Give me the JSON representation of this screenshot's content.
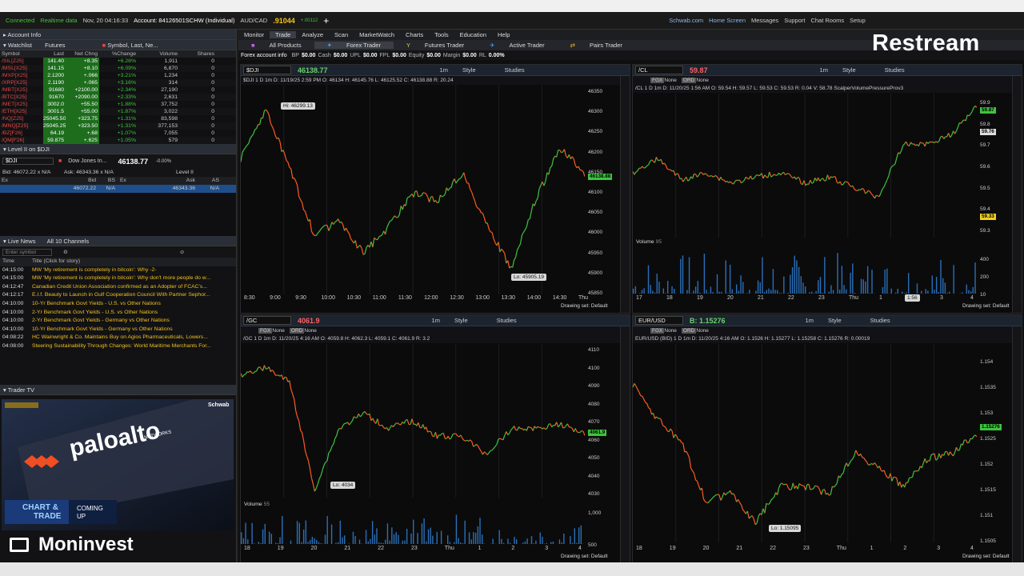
{
  "statusbar": {
    "connected": "Connected",
    "realtime": "Realtime data",
    "datetime": "Nov, 20  04:16:33",
    "account": "Account: 84126501SCHW (Individual)",
    "fx_symbol": "AUD/CAD",
    "fx_price": ".91044",
    "fx_change": "+.00112",
    "links": [
      "Schwab.com",
      "Home Screen",
      "Messages",
      "Support",
      "Chat Rooms",
      "Setup"
    ],
    "ondemand": "OnDemand"
  },
  "left_panel": {
    "account_info": "Account Info",
    "watchlist_label": "Watchlist",
    "watchlist_name": "Futures",
    "symbol_search": "Symbol, Last, Ne...",
    "columns": [
      "Symbol",
      "Last",
      "Net Chng",
      "%Change",
      "Volume",
      "Shares"
    ],
    "rows": [
      {
        "sym": "/SIL[Z25]",
        "last": "141.40",
        "net": "+8.35",
        "pct": "+6.28%",
        "vol": "1,911",
        "sh": "0"
      },
      {
        "sym": "/MSL[X25]",
        "last": "141.15",
        "net": "+8.10",
        "pct": "+6.09%",
        "vol": "6,870",
        "sh": "0"
      },
      {
        "sym": "/MXP[X25]",
        "last": "2.1200",
        "net": "+.066",
        "pct": "+3.21%",
        "vol": "1,234",
        "sh": "0"
      },
      {
        "sym": "/XRP[X25]",
        "last": "2.1190",
        "net": "+.065",
        "pct": "+3.16%",
        "vol": "314",
        "sh": "0"
      },
      {
        "sym": "/MBT[X25]",
        "last": "91680",
        "net": "+2100.00",
        "pct": "+2.34%",
        "vol": "27,190",
        "sh": "0"
      },
      {
        "sym": "/BTC[X25]",
        "last": "91670",
        "net": "+2090.00",
        "pct": "+2.33%",
        "vol": "2,631",
        "sh": "0"
      },
      {
        "sym": "/MET[X25]",
        "last": "3002.0",
        "net": "+55.50",
        "pct": "+1.88%",
        "vol": "37,752",
        "sh": "0"
      },
      {
        "sym": "/ETH[X25]",
        "last": "3001.5",
        "net": "+55.00",
        "pct": "+1.87%",
        "vol": "3,022",
        "sh": "0"
      },
      {
        "sym": "/NQ[Z25]",
        "last": "25045.50",
        "net": "+323.75",
        "pct": "+1.31%",
        "vol": "83,598",
        "sh": "0"
      },
      {
        "sym": "/MNQ[Z25]",
        "last": "25045.25",
        "net": "+323.50",
        "pct": "+1.31%",
        "vol": "377,153",
        "sh": "0"
      },
      {
        "sym": "/BZ[F26]",
        "last": "64.19",
        "net": "+.68",
        "pct": "+1.07%",
        "vol": "7,055",
        "sh": "0"
      },
      {
        "sym": "/QM[F26]",
        "last": "59.875",
        "net": "+.625",
        "pct": "+1.05%",
        "vol": "579",
        "sh": "0"
      }
    ],
    "level2_title": "Level II on $DJI",
    "level2_symbol": "$DJI",
    "level2_name": "Dow Jones In...",
    "level2_price": "46138.77",
    "level2_change": "-0.00%",
    "level2_bid": "Bid: 46072.22 x N/A",
    "level2_ask": "Ask: 46343.36 x N/A",
    "level2_label": "Level II",
    "level2_cols": [
      "Ex",
      "Bid",
      "BS",
      "Ex",
      "Ask",
      "AS"
    ],
    "level2_row": {
      "bid": "46072.22",
      "bs": "N/A",
      "ask": "46343.36",
      "as": "N/A"
    },
    "news_tab1": "Live News",
    "news_tab2": "All 10 Channels",
    "news_symbol_placeholder": "Enter symbol",
    "news_cols": [
      "Time",
      "Title (Click for story)"
    ],
    "news": [
      {
        "t": "04:15:00",
        "h": "MW 'My retirement is completely in bitcoin': Why -2-"
      },
      {
        "t": "04:15:00",
        "h": "MW 'My retirement is completely in bitcoin': Why don't more people do w..."
      },
      {
        "t": "04:12:47",
        "h": "Canadian Credit Union Association confirmed as an Adopter of FCAC's..."
      },
      {
        "t": "04:12:17",
        "h": "E.I.f. Beauty to Launch in Gulf Cooperation Council With Partner Sephor..."
      },
      {
        "t": "04:10:00",
        "h": "10-Yr Benchmark Govt Yields - U.S. vs Other Nations"
      },
      {
        "t": "04:10:00",
        "h": "2-Yr Benchmark Govt Yields - U.S. vs Other Nations"
      },
      {
        "t": "04:10:00",
        "h": "2-Yr Benchmark Govt Yields - Germany vs Other Nations"
      },
      {
        "t": "04:10:00",
        "h": "10-Yr Benchmark Govt Yields - Germany vs Other Nations"
      },
      {
        "t": "04:08:22",
        "h": "HC Wainwright & Co. Maintains Buy on Agios Pharmaceuticals, Lowers..."
      },
      {
        "t": "04:08:00",
        "h": "Steering Sustainability Through Changes: World Maritime Merchants For..."
      }
    ],
    "trader_tv": "Trader TV",
    "tv_brand": "Schwab",
    "tv_logo": "paloalto",
    "tv_logo_sub": "NETWORKS",
    "tv_chart": "CHART &",
    "tv_trade": "TRADE",
    "tv_coming": "COMING",
    "tv_up": "UP"
  },
  "main": {
    "tabs": [
      "Monitor",
      "Trade",
      "Analyze",
      "Scan",
      "MarketWatch",
      "Charts",
      "Tools",
      "Education",
      "Help"
    ],
    "subtabs": [
      "All Products",
      "Forex Trader",
      "Futures Trader",
      "Active Trader",
      "Pairs Trader"
    ],
    "fx_bar": {
      "label": "Forex account info",
      "bp": "BP",
      "bp_v": "$0.00",
      "cash": "Cash",
      "cash_v": "$0.00",
      "upl": "UPL",
      "upl_v": "$0.00",
      "fpl": "FPL",
      "fpl_v": "$0.00",
      "equity": "Equity",
      "equity_v": "$0.00",
      "margin": "Margin",
      "margin_v": "$0.00",
      "rl": "RL",
      "rl_v": "0.00%"
    }
  },
  "charts": {
    "dji": {
      "symbol": "$DJI",
      "price": "46138.77",
      "info": "$DJI 1 D 1m   D: 11/19/25 2:59 PM  O: 46134  H: 46145.76  L: 46125.52  C: 46138.88  R: 20.24",
      "hi": "Hi: 46299.13",
      "lo": "Lo: 45905.19",
      "yticks": [
        "46350",
        "46300",
        "46250",
        "46200",
        "46150",
        "46100",
        "46050",
        "46000",
        "45950",
        "45900",
        "45850"
      ],
      "xticks": [
        "8:30",
        "9:00",
        "9:30",
        "10:00",
        "10:30",
        "11:00",
        "11:30",
        "12:00",
        "12:30",
        "13:00",
        "13:30",
        "14:00",
        "14:30",
        "Thu"
      ],
      "last_tag": "46138.88",
      "drawing_set": "Drawing set: Default"
    },
    "cl": {
      "symbol": "/CL",
      "price": "59.87",
      "info": "/CL 1 D 1m   D: 11/20/25 1:56 AM  O: 59.54  H: 59.57  L: 59.53  C: 59.53  R: 0.04  V: 58.78  ScalperVolumePressureProv3",
      "volume_label": "Volume",
      "volume_value": "95",
      "yticks": [
        "59.9",
        "59.8",
        "59.7",
        "59.6",
        "59.5",
        "59.4",
        "59.3"
      ],
      "vol_ticks": [
        "400",
        "200",
        "10"
      ],
      "xticks": [
        "17",
        "18",
        "19",
        "20",
        "21",
        "22",
        "23",
        "Thu",
        "1",
        "2",
        "3",
        "4"
      ],
      "crosshair_time": "1:56",
      "tag_green": "59.87",
      "tag_white": "59.76",
      "tag_yellow": "59.33",
      "drawing_set": "Drawing set: Default"
    },
    "gc": {
      "symbol": "/GC",
      "price": "4061.9",
      "info": "/GC 1 D 1m   D: 11/20/25 4:16 AM  O: 4059.8  H: 4062.3  L: 4059.1  C: 4061.9  R: 3.2",
      "lo": "Lo: 4034",
      "volume_label": "Volume",
      "volume_value": "55",
      "yticks": [
        "4110",
        "4100",
        "4090",
        "4080",
        "4070",
        "4060",
        "4050",
        "4040",
        "4030"
      ],
      "vol_ticks": [
        "1,000",
        "500"
      ],
      "xticks": [
        "18",
        "19",
        "20",
        "21",
        "22",
        "23",
        "Thu",
        "1",
        "2",
        "3",
        "4"
      ],
      "last_tag": "4061.9",
      "drawing_set": "Drawing set: Default"
    },
    "eurusd": {
      "symbol": "EUR/USD",
      "price": "B: 1.15276",
      "info": "EUR/USD (BID) 1 D 1m   D: 11/20/25 4:16 AM  O: 1.1526  H: 1.15277  L: 1.15258  C: 1.15276  R: 0.00019",
      "lo": "Lo: 1.15095",
      "yticks": [
        "1.154",
        "1.1535",
        "1.153",
        "1.1525",
        "1.152",
        "1.1515",
        "1.151",
        "1.1505"
      ],
      "xticks": [
        "18",
        "19",
        "20",
        "21",
        "22",
        "23",
        "Thu",
        "1",
        "2",
        "3",
        "4"
      ],
      "last_tag": "1.15276",
      "drawing_set": "Drawing set: Default"
    },
    "toolbar": {
      "period": "1m",
      "style": "Style",
      "studies": "Studies",
      "flexgrid": "FGX",
      "none": "None",
      "opt": "ORD"
    }
  },
  "overlays": {
    "restream": "Restream",
    "moninvest": "Moninvest"
  },
  "colors": {
    "up": "#3ec43e",
    "down": "#ff5a1f",
    "accent": "#1f6fbf",
    "yellow": "#f0c020"
  }
}
